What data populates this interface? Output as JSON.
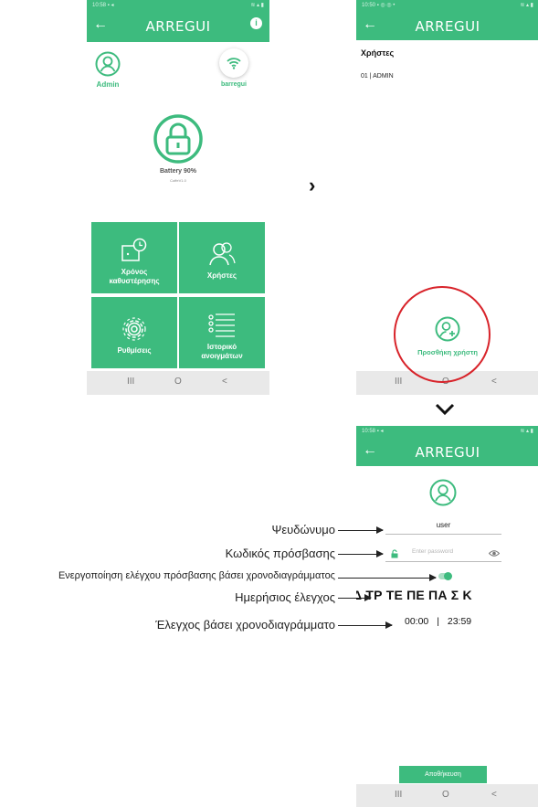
{
  "colors": {
    "accent": "#3dbb7e",
    "highlight_circle": "#d8232a"
  },
  "screen1": {
    "status_time": "10:58",
    "brand": "ARREGUI",
    "back_icon": "arrow-left-icon",
    "info_icon": "info-icon",
    "user_label": "Admin",
    "wifi_label": "barregui",
    "battery_text": "Battery 90%",
    "firmware_text": "CoffeV1.0",
    "tiles": [
      {
        "label": "Χρόνος καθυστέρησης",
        "icon": "clock-door-icon"
      },
      {
        "label": "Χρήστες",
        "icon": "users-icon"
      },
      {
        "label": "Ρυθμίσεις",
        "icon": "gear-icon"
      },
      {
        "label": "Ιστορικό ανοιγμάτων",
        "icon": "list-icon"
      }
    ]
  },
  "screen2": {
    "status_time": "10:50",
    "brand": "ARREGUI",
    "section_title": "Χρήστες",
    "users": [
      "01 | ADMIN"
    ],
    "add_user_label": "Προσθήκη χρήστη"
  },
  "screen3": {
    "status_time": "10:58",
    "brand": "ARREGUI",
    "username_value": "user",
    "password_placeholder": "Enter password",
    "days": "Δ ΤΡ ΤΕ ΠΕ ΠΑ Σ Κ",
    "time_start": "00:00",
    "time_sep": "|",
    "time_end": "23:59",
    "save_label": "Αποθήκευση"
  },
  "annotations": {
    "nickname": "Ψευδώνυμο",
    "password": "Κωδικός πρόσβασης",
    "schedule_toggle": "Ενεργοποίηση ελέγχου πρόσβασης βάσει χρονοδιαγράμματος",
    "daily": "Ημερήσιος έλεγχος",
    "time": "Έλεγχος βάσει χρονοδιαγράμματο"
  },
  "nav": {
    "recents": "III",
    "home": "O",
    "back": "<"
  }
}
